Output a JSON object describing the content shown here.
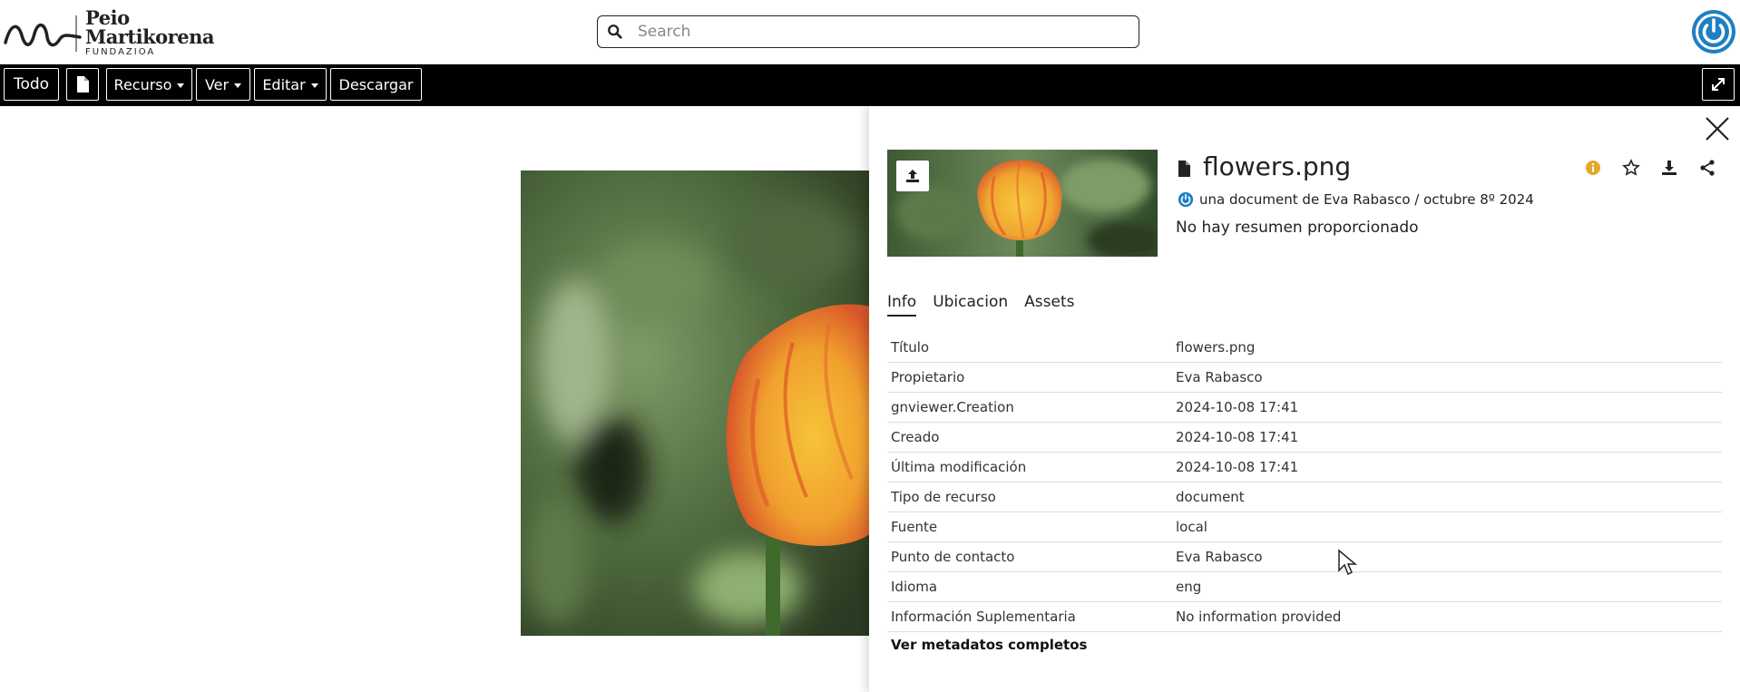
{
  "header": {
    "logo": {
      "line1": "Peio",
      "line2": "Martikorena",
      "line3": "FUNDAZIOA"
    },
    "search": {
      "placeholder": "Search",
      "icon": "search-icon"
    },
    "avatar_icon": "power-icon",
    "accent_color": "#1e7fc2"
  },
  "toolbar": {
    "buttons": [
      {
        "label": "Todo"
      },
      {
        "label": "",
        "icon": "document-icon"
      },
      {
        "label": "Recurso",
        "dropdown": true
      },
      {
        "label": "Ver",
        "dropdown": true
      },
      {
        "label": "Editar",
        "dropdown": true
      },
      {
        "label": "Descargar"
      }
    ],
    "expand_icon": "expand-icon"
  },
  "panel": {
    "title": "flowers.png",
    "subtitle": "una document de Eva Rabasco / octubre 8º 2024",
    "summary": "No hay resumen proporcionado",
    "tabs": [
      "Info",
      "Ubicacion",
      "Assets"
    ],
    "active_tab": "Info",
    "info_rows": [
      {
        "key": "Título",
        "value": "flowers.png"
      },
      {
        "key": "Propietario",
        "value": "Eva Rabasco"
      },
      {
        "key": "gnviewer.Creation",
        "value": "2024-10-08 17:41"
      },
      {
        "key": "Creado",
        "value": "2024-10-08 17:41"
      },
      {
        "key": "Última modificación",
        "value": "2024-10-08 17:41"
      },
      {
        "key": "Tipo de recurso",
        "value": "document"
      },
      {
        "key": "Fuente",
        "value": "local"
      },
      {
        "key": "Punto de contacto",
        "value": "Eva Rabasco"
      },
      {
        "key": "Idioma",
        "value": "eng"
      },
      {
        "key": "Información Suplementaria",
        "value": "No information provided"
      }
    ],
    "full_metadata_link": "Ver metadatos completos",
    "info_icon_color": "#e2a92b"
  }
}
